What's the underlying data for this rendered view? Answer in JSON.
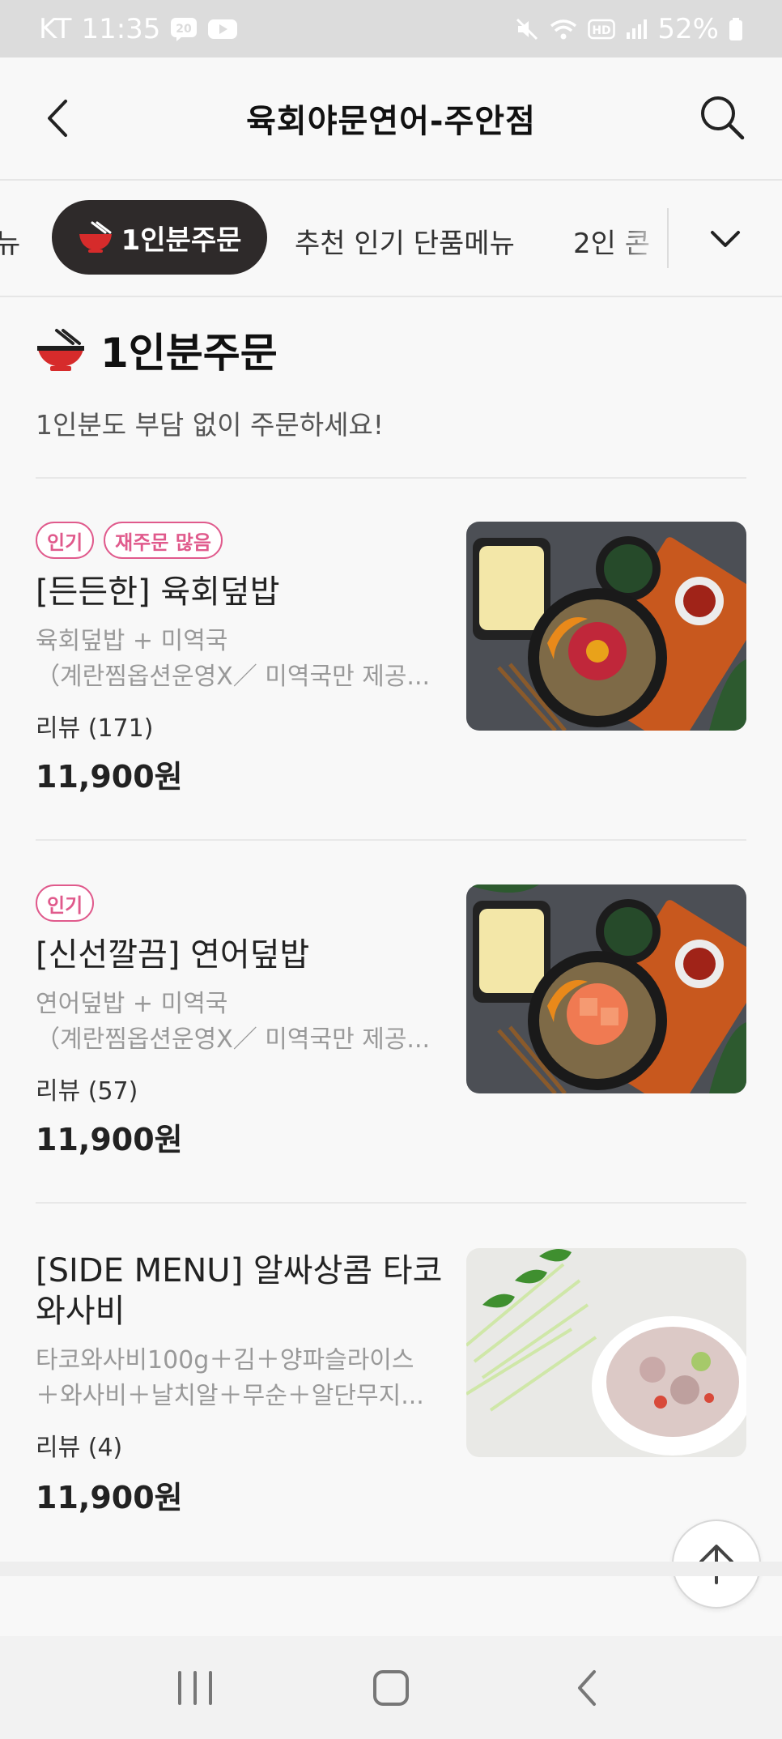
{
  "status_bar": {
    "carrier": "KT",
    "time": "11:35",
    "notif_badge": "20",
    "hd_label": "HD",
    "battery": "52%",
    "icons": [
      "notification-badge-icon",
      "youtube-icon",
      "mute-icon",
      "wifi-icon",
      "hd-icon",
      "signal-icon",
      "battery-icon"
    ]
  },
  "header": {
    "title": "육회야문연어-주안점",
    "back_icon": "chevron-left-icon",
    "search_icon": "search-icon"
  },
  "tabs": {
    "partial_left": "뉴",
    "active": "1인분주문",
    "recommended": "추천 인기 단품메뉴",
    "partial_right": "2인 콘",
    "expand_icon": "chevron-down-icon"
  },
  "section": {
    "title": "1인분주문",
    "icon": "noodle-bowl-icon",
    "description": "1인분도 부담 없이 주문하세요!"
  },
  "menu_items": [
    {
      "badges": [
        "인기",
        "재주문 많음"
      ],
      "name": "[든든한] 육회덮밥",
      "desc_line1": "육회덮밥 + 미역국",
      "desc_line2": "（계란찜옵션운영X／ 미역국만 제공...",
      "review": "리뷰 (171)",
      "price": "11,900원",
      "image": "yukhoe-rice-bowl-photo"
    },
    {
      "badges": [
        "인기"
      ],
      "name": "[신선깔끔] 연어덮밥",
      "desc_line1": "연어덮밥 + 미역국",
      "desc_line2": "（계란찜옵션운영X／ 미역국만 제공...",
      "review": "리뷰 (57)",
      "price": "11,900원",
      "image": "salmon-rice-bowl-photo"
    },
    {
      "badges": [],
      "name": "[SIDE MENU] 알싸상콤 타코와사비",
      "desc_line1": "타코와사비100g＋김＋양파슬라이스",
      "desc_line2": "＋와사비＋날치알＋무순＋알단무지...",
      "review": "리뷰 (4)",
      "price": "11,900원",
      "image": "tako-wasabi-photo"
    }
  ],
  "colors": {
    "accent_pink": "#e05a8c",
    "active_tab_bg": "#2e2a2a",
    "bowl_red": "#d62b2b"
  },
  "fab_icon": "arrow-up-icon",
  "nav": {
    "recents_icon": "recents-icon",
    "home_icon": "home-icon",
    "back_icon": "nav-back-icon"
  }
}
